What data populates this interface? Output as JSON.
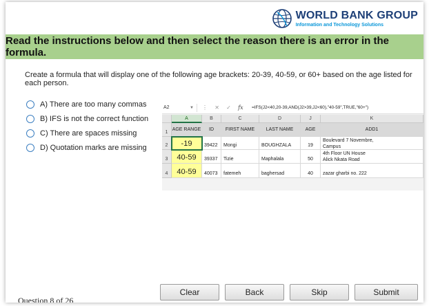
{
  "logo": {
    "main": "WORLD BANK GROUP",
    "sub": "Information and Technology Solutions",
    "icon": "globe-icon",
    "color": "#1d3f77",
    "sub_color": "#0a97d9"
  },
  "banner": {
    "text": "Read the instructions below and then select the reason there is an error in the formula.",
    "color": "#a8d08d"
  },
  "instructions": "Create a formula that will display one of the following age brackets: 20-39, 40-59, or 60+ based on the age listed for each person.",
  "options": [
    {
      "label": "A) There are too many commas"
    },
    {
      "label": "B) IFS is not the correct function"
    },
    {
      "label": "C) There are spaces missing"
    },
    {
      "label": "D) Quotation marks are missing"
    }
  ],
  "spreadsheet": {
    "name_box": "A2",
    "fx": "fx",
    "formula": "=IFS(J2<40,20-39,AND(J2>39,J2<60),\"40-59\",TRUE,\"60+\")",
    "column_letters": [
      "A",
      "B",
      "C",
      "D",
      "J",
      "K"
    ],
    "row_numbers": [
      "1",
      "2",
      "3",
      "4"
    ],
    "headers": [
      "AGE RANGE",
      "ID",
      "FIRST NAME",
      "LAST NAME",
      "AGE",
      "ADD1"
    ],
    "rows": [
      {
        "range": "-19",
        "id": "39422",
        "first": "Mongi",
        "last": "BOUGHZALA",
        "age": "19",
        "add1_line1": "Boulevard 7 Novembre,",
        "add1_line2": "Campus"
      },
      {
        "range": "40-59",
        "id": "39337",
        "first": "Tizie",
        "last": "Maphalala",
        "age": "50",
        "add1_line1": "4th Floor UN House",
        "add1_line2": "Alick Nkata Road"
      },
      {
        "range": "40-59",
        "id": "40073",
        "first": "fatemeh",
        "last": "baghersad",
        "age": "40",
        "add1_line1": "",
        "add1_line2": "zazar gharbi no. 222"
      }
    ],
    "highlight_color": "#ffff99"
  },
  "footer": {
    "question_counter": "Question 8 of 26",
    "buttons": {
      "clear": "Clear",
      "back": "Back",
      "skip": "Skip",
      "submit": "Submit"
    }
  }
}
